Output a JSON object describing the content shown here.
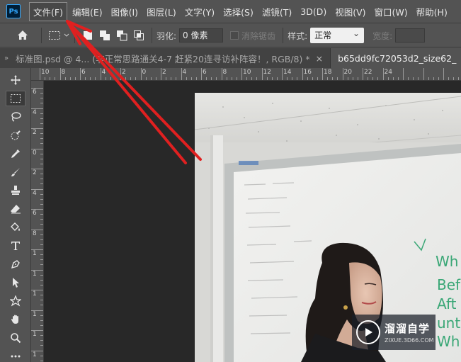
{
  "app": {
    "logo_text": "Ps",
    "accent_color": "#31a8ff",
    "annotation_color": "#e02020"
  },
  "menu": {
    "items": [
      {
        "label": "文件(F)",
        "active": true
      },
      {
        "label": "编辑(E)"
      },
      {
        "label": "图像(I)"
      },
      {
        "label": "图层(L)"
      },
      {
        "label": "文字(Y)"
      },
      {
        "label": "选择(S)"
      },
      {
        "label": "滤镜(T)"
      },
      {
        "label": "3D(D)"
      },
      {
        "label": "视图(V)"
      },
      {
        "label": "窗口(W)"
      },
      {
        "label": "帮助(H)"
      }
    ]
  },
  "options": {
    "home_icon": "home-icon",
    "marquee_icon": "rect-marquee-icon",
    "feather_label": "羽化:",
    "feather_value": "0 像素",
    "antialias_label": "消除锯齿",
    "style_label": "样式:",
    "style_value": "正常",
    "width_label": "宽度:"
  },
  "tabs": {
    "gutter": "»",
    "items": [
      {
        "label": "标准图.psd @ 4... (非正常思路通关4-7 赶紧20连寻访补阵容！, RGB/8) *",
        "active": false,
        "close": "×"
      },
      {
        "label": "b65dd9fc72053d2_size62_",
        "active": true,
        "close": ""
      }
    ]
  },
  "tools": [
    "move-tool-icon",
    "rect-marquee-tool-icon",
    "lasso-tool-icon",
    "quick-select-tool-icon",
    "eyedropper-tool-icon",
    "brush-tool-icon",
    "stamp-tool-icon",
    "eraser-tool-icon",
    "paint-bucket-tool-icon",
    "type-tool-icon",
    "pen-tool-icon",
    "path-select-tool-icon",
    "shape-tool-icon",
    "hand-tool-icon",
    "zoom-tool-icon",
    "more-tools-icon"
  ],
  "ruler_h": {
    "labels": [
      "10",
      "8",
      "6",
      "4",
      "2",
      "0",
      "2",
      "4",
      "6",
      "8",
      "10",
      "12",
      "14",
      "16",
      "18",
      "20",
      "22",
      "24"
    ]
  },
  "ruler_v": {
    "labels": [
      "6",
      "4",
      "2",
      "0",
      "2",
      "4",
      "6",
      "8",
      "1",
      "1",
      "1",
      "1",
      "1",
      "1"
    ]
  },
  "canvas": {
    "whiteboard_text": [
      "Wh",
      "Bef",
      "Aft",
      "unt",
      "Whi"
    ]
  },
  "watermark": {
    "title": "溜溜自学",
    "subtitle": "ZIXUE.3D66.COM"
  }
}
